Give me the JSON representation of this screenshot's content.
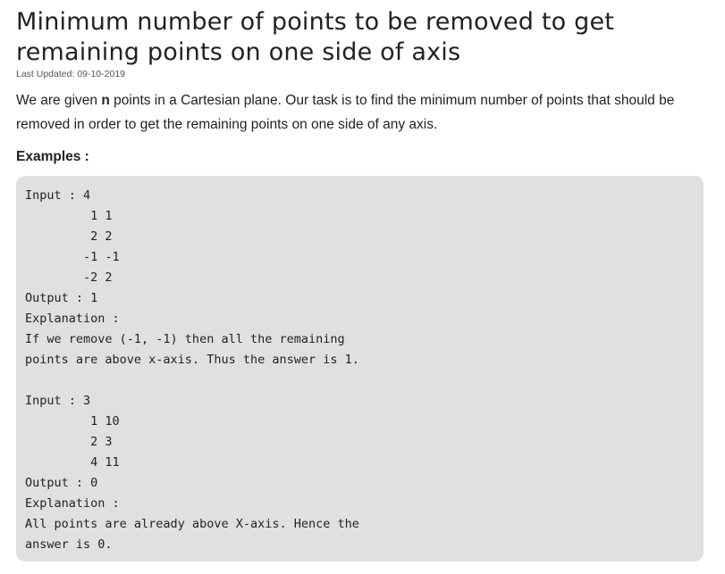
{
  "article": {
    "title": "Minimum number of points to be removed to get remaining points on one side of axis",
    "last_updated": "Last Updated: 09-10-2019",
    "intro_before": "We are given ",
    "intro_bold": "n",
    "intro_after": " points in a Cartesian plane. Our task is to find the minimum number of points that should be removed in order to get the remaining points on one side of any axis.",
    "examples_heading": "Examples :",
    "code_lines": [
      "Input : 4",
      "         1 1",
      "         2 2",
      "        -1 -1",
      "        -2 2",
      "Output : 1",
      "Explanation :",
      "If we remove (-1, -1) then all the remaining",
      "points are above x-axis. Thus the answer is 1.",
      "",
      "Input : 3",
      "         1 10",
      "         2 3",
      "         4 11",
      "Output : 0",
      "Explanation :",
      "All points are already above X-axis. Hence the",
      "answer is 0."
    ]
  }
}
